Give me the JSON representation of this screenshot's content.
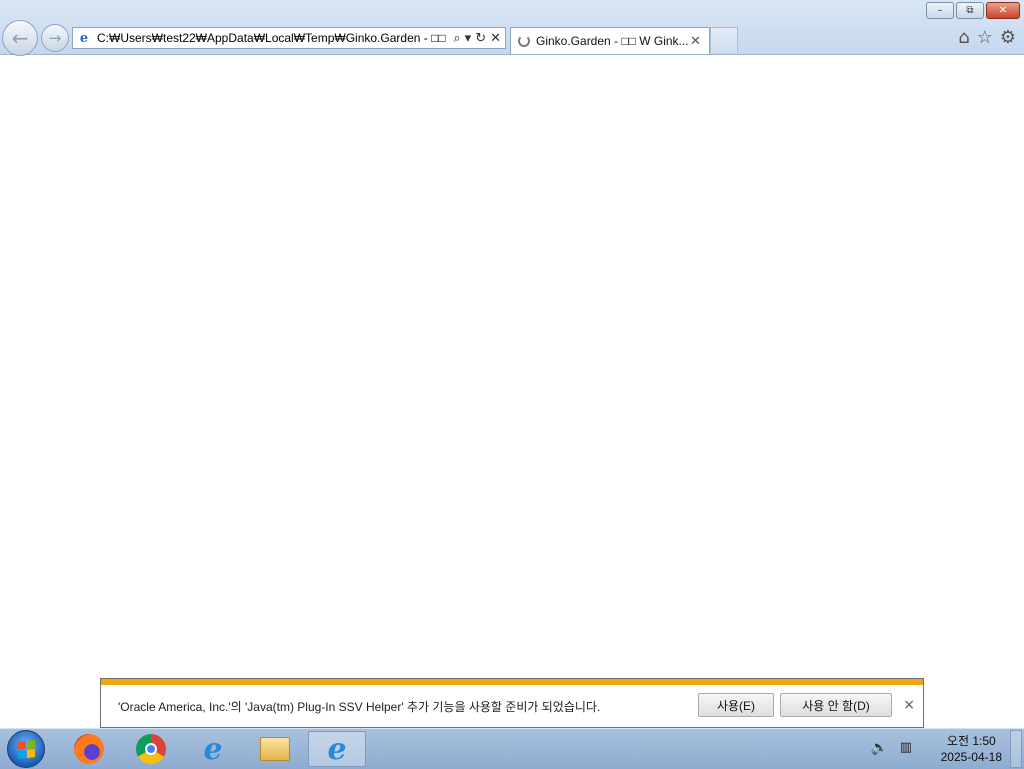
{
  "browser": {
    "address_url": "C:₩Users₩test22₩AppData₩Local₩Temp₩Ginko.Garden - □□ \\",
    "tab_title": "Ginko.Garden - □□ W Gink...",
    "window_controls": {
      "minimize": "–",
      "restore": "⧉",
      "close": "✕"
    },
    "nav": {
      "back": "←",
      "forward": "→"
    },
    "address_actions": {
      "search": "⌕",
      "dropdown": "▾",
      "refresh": "↻",
      "stop": "✕"
    },
    "tab_close": "✕",
    "toolbar": {
      "home": "⌂",
      "favorites": "☆",
      "tools": "⚙"
    }
  },
  "notification": {
    "message": "'Oracle America, Inc.'의 'Java(tm) Plug-In SSV Helper' 추가 기능을 사용할 준비가 되었습니다.",
    "enable_label": "사용(E)",
    "disable_label": "사용 안 함(D)",
    "close": "×",
    "accent_color": "#f2a60f"
  },
  "taskbar": {
    "pinned": [
      "firefox-icon",
      "chrome-icon",
      "internet-explorer-icon",
      "file-explorer-icon",
      "internet-explorer-icon"
    ],
    "clock_time": "오전 1:50",
    "clock_date": "2025-04-18",
    "tray_volume": "🔈",
    "tray_network": "▥"
  }
}
